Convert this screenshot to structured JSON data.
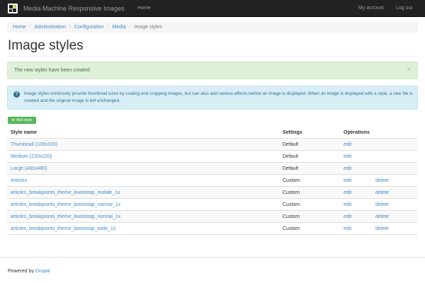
{
  "navbar": {
    "brand": "Media Machine Responsive Images",
    "home": "Home",
    "account": "My account",
    "logout": "Log out"
  },
  "breadcrumb": [
    "Home",
    "Administration",
    "Configuration",
    "Media",
    "Image styles"
  ],
  "page_title": "Image styles",
  "alerts": {
    "success": "The new styles have been created",
    "close": "×",
    "info_icon": "?",
    "info": "Image styles commonly provide thumbnail sizes by scaling and cropping images, but can also add various effects before an image is displayed. When an image is displayed with a style, a new file is created and the original image is left unchanged."
  },
  "add_button": {
    "plus": "+",
    "label": "Add style"
  },
  "table": {
    "headers": {
      "name": "Style name",
      "settings": "Settings",
      "operations": "Operations"
    },
    "rows": [
      {
        "name": "Thumbnail (100x100)",
        "settings": "Default",
        "edit": "edit",
        "delete": ""
      },
      {
        "name": "Medium (220x220)",
        "settings": "Default",
        "edit": "edit",
        "delete": ""
      },
      {
        "name": "Large (480x480)",
        "settings": "Default",
        "edit": "edit",
        "delete": ""
      },
      {
        "name": "Articles",
        "settings": "Custom",
        "edit": "edit",
        "delete": "delete"
      },
      {
        "name": "articles_breakpoints_theme_bootstrap_mobile_1x",
        "settings": "Custom",
        "edit": "edit",
        "delete": "delete"
      },
      {
        "name": "articles_breakpoints_theme_bootstrap_narrow_1x",
        "settings": "Custom",
        "edit": "edit",
        "delete": "delete"
      },
      {
        "name": "articles_breakpoints_theme_bootstrap_normal_1x",
        "settings": "Custom",
        "edit": "edit",
        "delete": "delete"
      },
      {
        "name": "articles_breakpoints_theme_bootstrap_wide_1x",
        "settings": "Custom",
        "edit": "edit",
        "delete": "delete"
      }
    ]
  },
  "footer": {
    "prefix": "Powered by",
    "link": "Drupal"
  },
  "colors": {
    "navbar": "#222222",
    "link": "#428bca",
    "success_bg": "#dff0d8",
    "info_bg": "#d9edf7",
    "button_green": "#5cb85c"
  },
  "icons": {
    "logo": "media-machine-logo-icon",
    "close": "close-icon",
    "info": "info-icon",
    "add": "plus-icon"
  }
}
